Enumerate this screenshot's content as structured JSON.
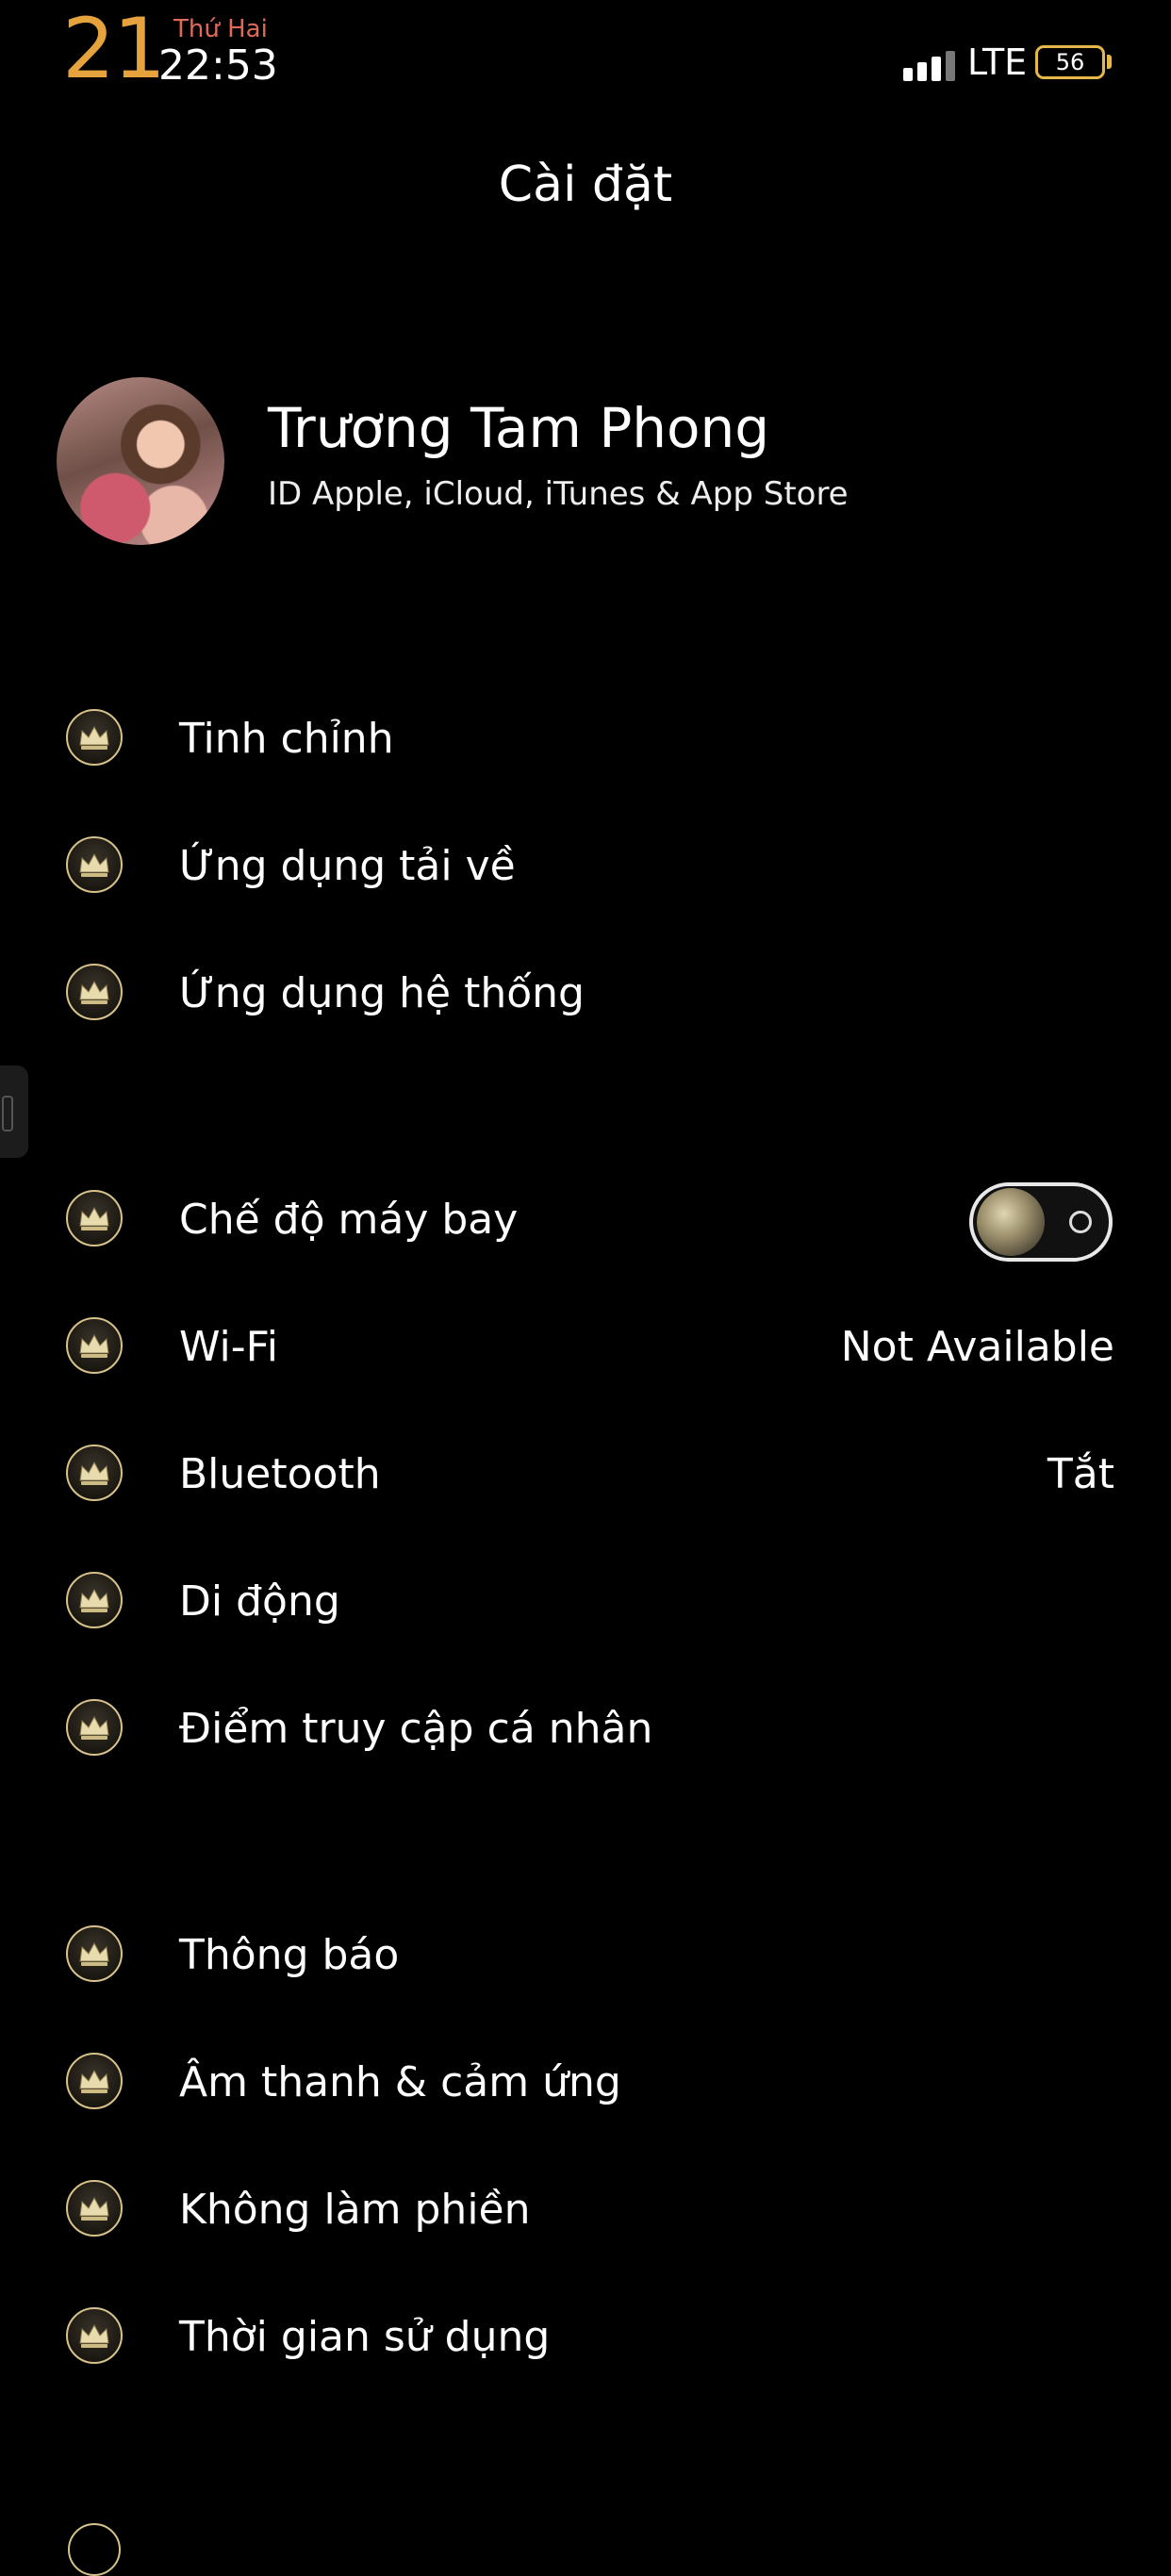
{
  "status_bar": {
    "day": "21",
    "weekday": "Thứ Hai",
    "time": "22:53",
    "network": "LTE",
    "battery": "56",
    "accent_color": "#e6a23c"
  },
  "header": {
    "title": "Cài đặt"
  },
  "profile": {
    "name": "Trương Tam Phong",
    "subtitle": "ID Apple, iCloud, iTunes & App Store"
  },
  "group1": [
    {
      "label": "Tinh chỉnh",
      "icon": "crown-icon"
    },
    {
      "label": "Ứng dụng tải về",
      "icon": "crown-icon"
    },
    {
      "label": "Ứng dụng hệ thống",
      "icon": "crown-icon"
    }
  ],
  "group2": [
    {
      "label": "Chế độ máy bay",
      "icon": "crown-icon",
      "toggle_on": false
    },
    {
      "label": "Wi-Fi",
      "icon": "crown-icon",
      "value": "Not Available"
    },
    {
      "label": "Bluetooth",
      "icon": "crown-icon",
      "value": "Tắt"
    },
    {
      "label": "Di động",
      "icon": "crown-icon"
    },
    {
      "label": "Điểm truy cập cá nhân",
      "icon": "crown-icon"
    }
  ],
  "group3": [
    {
      "label": "Thông báo",
      "icon": "crown-icon"
    },
    {
      "label": "Âm thanh & cảm ứng",
      "icon": "crown-icon"
    },
    {
      "label": "Không làm phiền",
      "icon": "crown-icon"
    },
    {
      "label": "Thời gian sử dụng",
      "icon": "crown-icon"
    }
  ]
}
